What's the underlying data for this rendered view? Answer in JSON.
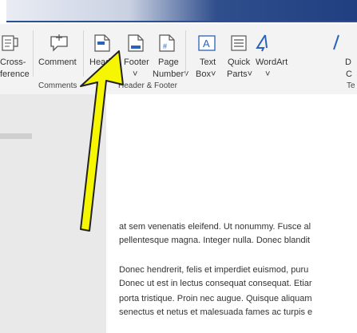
{
  "ribbon": {
    "items": [
      {
        "id": "cross-reference",
        "line1": "Cross-",
        "line2": "ference"
      },
      {
        "id": "comment",
        "line1": "Comment",
        "line2": ""
      },
      {
        "id": "header",
        "line1": "Header",
        "line2": "˅"
      },
      {
        "id": "footer",
        "line1": "Footer",
        "line2": "˅"
      },
      {
        "id": "page-number",
        "line1": "Page",
        "line2": "Number˅"
      },
      {
        "id": "text-box",
        "line1": "Text",
        "line2": "Box˅"
      },
      {
        "id": "quick-parts",
        "line1": "Quick",
        "line2": "Parts˅"
      },
      {
        "id": "wordart",
        "line1": "WordArt",
        "line2": "˅"
      },
      {
        "id": "drop-cap",
        "line1": "D",
        "line2": "C"
      }
    ],
    "groups": {
      "comments": "Comments",
      "header_footer": "Header & Footer",
      "text_truncated": "Te"
    }
  },
  "document": {
    "lines": [
      "at sem venenatis eleifend. Ut nonummy. Fusce al",
      "pellentesque magna. Integer nulla. Donec blandit",
      "Donec hendrerit, felis et imperdiet euismod, puru",
      "Donec ut est in lectus consequat consequat. Etiar",
      "porta tristique. Proin nec augue. Quisque aliquam",
      "senectus et netus et malesuada fames ac turpis e"
    ]
  },
  "colors": {
    "arrow_fill": "#f6f600",
    "arrow_stroke": "#222222",
    "ribbon_bg": "#f3f3f3",
    "title_accent": "#1f3f80"
  }
}
